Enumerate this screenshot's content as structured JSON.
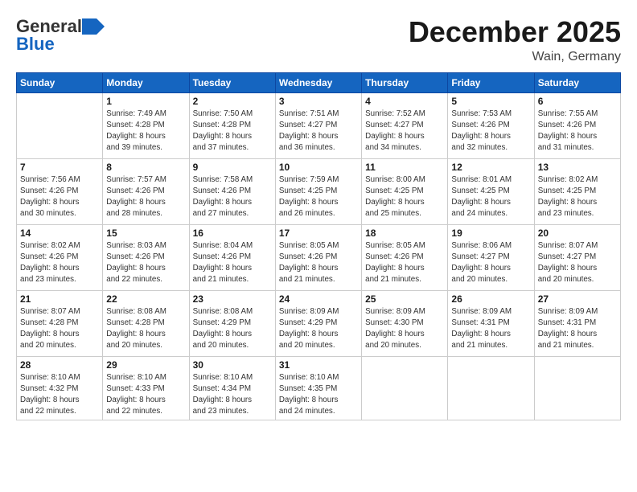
{
  "logo": {
    "general": "General",
    "blue": "Blue"
  },
  "title": "December 2025",
  "location": "Wain, Germany",
  "days_header": [
    "Sunday",
    "Monday",
    "Tuesday",
    "Wednesday",
    "Thursday",
    "Friday",
    "Saturday"
  ],
  "weeks": [
    [
      {
        "day": "",
        "info": ""
      },
      {
        "day": "1",
        "info": "Sunrise: 7:49 AM\nSunset: 4:28 PM\nDaylight: 8 hours\nand 39 minutes."
      },
      {
        "day": "2",
        "info": "Sunrise: 7:50 AM\nSunset: 4:28 PM\nDaylight: 8 hours\nand 37 minutes."
      },
      {
        "day": "3",
        "info": "Sunrise: 7:51 AM\nSunset: 4:27 PM\nDaylight: 8 hours\nand 36 minutes."
      },
      {
        "day": "4",
        "info": "Sunrise: 7:52 AM\nSunset: 4:27 PM\nDaylight: 8 hours\nand 34 minutes."
      },
      {
        "day": "5",
        "info": "Sunrise: 7:53 AM\nSunset: 4:26 PM\nDaylight: 8 hours\nand 32 minutes."
      },
      {
        "day": "6",
        "info": "Sunrise: 7:55 AM\nSunset: 4:26 PM\nDaylight: 8 hours\nand 31 minutes."
      }
    ],
    [
      {
        "day": "7",
        "info": "Sunrise: 7:56 AM\nSunset: 4:26 PM\nDaylight: 8 hours\nand 30 minutes."
      },
      {
        "day": "8",
        "info": "Sunrise: 7:57 AM\nSunset: 4:26 PM\nDaylight: 8 hours\nand 28 minutes."
      },
      {
        "day": "9",
        "info": "Sunrise: 7:58 AM\nSunset: 4:26 PM\nDaylight: 8 hours\nand 27 minutes."
      },
      {
        "day": "10",
        "info": "Sunrise: 7:59 AM\nSunset: 4:25 PM\nDaylight: 8 hours\nand 26 minutes."
      },
      {
        "day": "11",
        "info": "Sunrise: 8:00 AM\nSunset: 4:25 PM\nDaylight: 8 hours\nand 25 minutes."
      },
      {
        "day": "12",
        "info": "Sunrise: 8:01 AM\nSunset: 4:25 PM\nDaylight: 8 hours\nand 24 minutes."
      },
      {
        "day": "13",
        "info": "Sunrise: 8:02 AM\nSunset: 4:25 PM\nDaylight: 8 hours\nand 23 minutes."
      }
    ],
    [
      {
        "day": "14",
        "info": "Sunrise: 8:02 AM\nSunset: 4:26 PM\nDaylight: 8 hours\nand 23 minutes."
      },
      {
        "day": "15",
        "info": "Sunrise: 8:03 AM\nSunset: 4:26 PM\nDaylight: 8 hours\nand 22 minutes."
      },
      {
        "day": "16",
        "info": "Sunrise: 8:04 AM\nSunset: 4:26 PM\nDaylight: 8 hours\nand 21 minutes."
      },
      {
        "day": "17",
        "info": "Sunrise: 8:05 AM\nSunset: 4:26 PM\nDaylight: 8 hours\nand 21 minutes."
      },
      {
        "day": "18",
        "info": "Sunrise: 8:05 AM\nSunset: 4:26 PM\nDaylight: 8 hours\nand 21 minutes."
      },
      {
        "day": "19",
        "info": "Sunrise: 8:06 AM\nSunset: 4:27 PM\nDaylight: 8 hours\nand 20 minutes."
      },
      {
        "day": "20",
        "info": "Sunrise: 8:07 AM\nSunset: 4:27 PM\nDaylight: 8 hours\nand 20 minutes."
      }
    ],
    [
      {
        "day": "21",
        "info": "Sunrise: 8:07 AM\nSunset: 4:28 PM\nDaylight: 8 hours\nand 20 minutes."
      },
      {
        "day": "22",
        "info": "Sunrise: 8:08 AM\nSunset: 4:28 PM\nDaylight: 8 hours\nand 20 minutes."
      },
      {
        "day": "23",
        "info": "Sunrise: 8:08 AM\nSunset: 4:29 PM\nDaylight: 8 hours\nand 20 minutes."
      },
      {
        "day": "24",
        "info": "Sunrise: 8:09 AM\nSunset: 4:29 PM\nDaylight: 8 hours\nand 20 minutes."
      },
      {
        "day": "25",
        "info": "Sunrise: 8:09 AM\nSunset: 4:30 PM\nDaylight: 8 hours\nand 20 minutes."
      },
      {
        "day": "26",
        "info": "Sunrise: 8:09 AM\nSunset: 4:31 PM\nDaylight: 8 hours\nand 21 minutes."
      },
      {
        "day": "27",
        "info": "Sunrise: 8:09 AM\nSunset: 4:31 PM\nDaylight: 8 hours\nand 21 minutes."
      }
    ],
    [
      {
        "day": "28",
        "info": "Sunrise: 8:10 AM\nSunset: 4:32 PM\nDaylight: 8 hours\nand 22 minutes."
      },
      {
        "day": "29",
        "info": "Sunrise: 8:10 AM\nSunset: 4:33 PM\nDaylight: 8 hours\nand 22 minutes."
      },
      {
        "day": "30",
        "info": "Sunrise: 8:10 AM\nSunset: 4:34 PM\nDaylight: 8 hours\nand 23 minutes."
      },
      {
        "day": "31",
        "info": "Sunrise: 8:10 AM\nSunset: 4:35 PM\nDaylight: 8 hours\nand 24 minutes."
      },
      {
        "day": "",
        "info": ""
      },
      {
        "day": "",
        "info": ""
      },
      {
        "day": "",
        "info": ""
      }
    ]
  ]
}
